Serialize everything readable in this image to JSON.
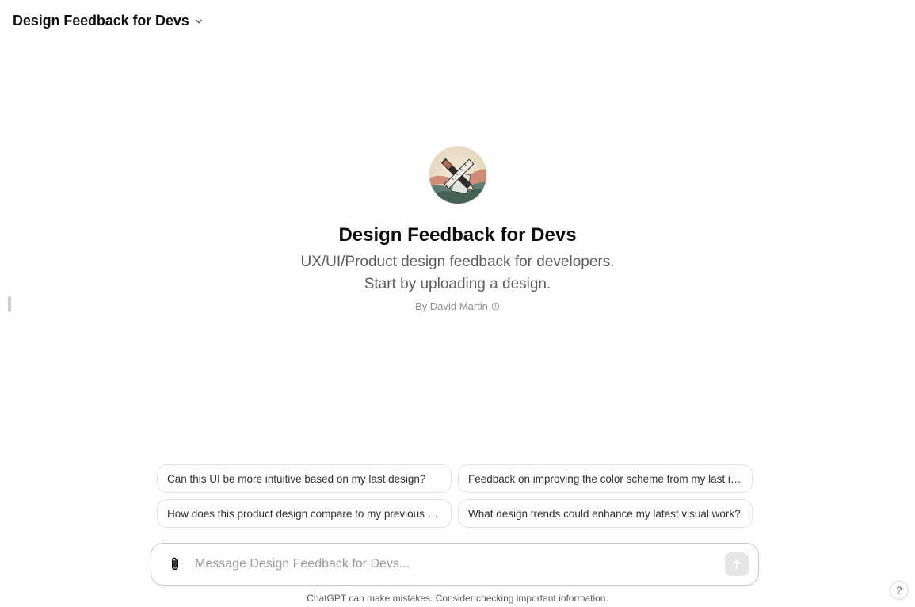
{
  "header": {
    "title": "Design Feedback for Devs",
    "chevron_icon": "chevron-down-icon"
  },
  "profile": {
    "name": "Design Feedback for Devs",
    "description_line1": "UX/UI/Product design feedback for developers.",
    "description_line2": "Start by uploading a design.",
    "author": "By David Martin",
    "info_icon": "info-circle-icon",
    "avatar_icon": "pencil-ruler-icon"
  },
  "suggestions": [
    "Can this UI be more intuitive based on my last design?",
    "Feedback on improving the color scheme from my last image.",
    "How does this product design compare to my previous ones?",
    "What design trends could enhance my latest visual work?"
  ],
  "composer": {
    "placeholder": "Message Design Feedback for Devs...",
    "attach_icon": "paperclip-icon",
    "send_icon": "arrow-up-icon"
  },
  "disclaimer": "ChatGPT can make mistakes. Consider checking important information.",
  "help_label": "?",
  "colors": {
    "text": "#0d0d0d",
    "muted": "#5d5d5d",
    "border": "#e3e3e3",
    "send_bg": "#e5e5e5"
  }
}
